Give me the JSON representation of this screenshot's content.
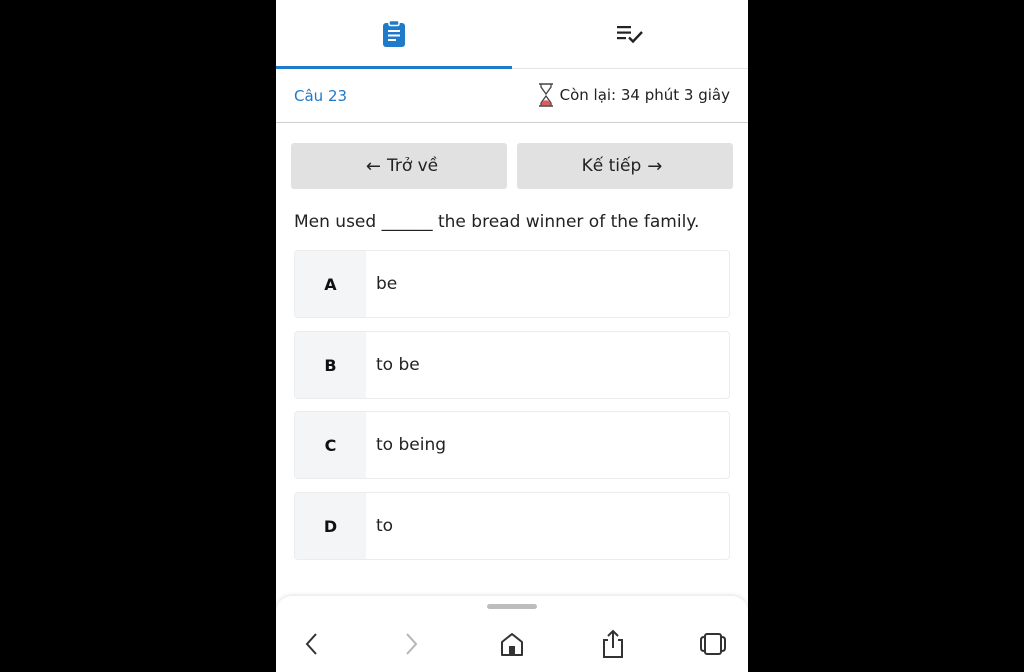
{
  "tabs": [
    {
      "name": "question-tab",
      "icon": "clipboard-icon",
      "active": true
    },
    {
      "name": "answer-list-tab",
      "icon": "checklist-icon",
      "active": false
    }
  ],
  "status": {
    "question_number": "Câu 23",
    "time_remaining": "Còn lại: 34 phút 3 giây",
    "timer_icon": "hourglass-icon"
  },
  "navigation": {
    "back_label": "Trở về",
    "next_label": "Kế tiếp"
  },
  "question": {
    "text": "Men used ______ the bread winner of the family."
  },
  "options": [
    {
      "letter": "A",
      "text": "be"
    },
    {
      "letter": "B",
      "text": "to be"
    },
    {
      "letter": "C",
      "text": "to being"
    },
    {
      "letter": "D",
      "text": "to"
    }
  ],
  "browser_bar": {
    "icons": [
      "back-icon",
      "forward-icon",
      "home-icon",
      "share-icon",
      "tabs-icon"
    ]
  },
  "colors": {
    "accent": "#1f7ac9",
    "button_bg": "#e1e1e1",
    "option_letter_bg": "#f4f5f7",
    "background": "#000000"
  }
}
